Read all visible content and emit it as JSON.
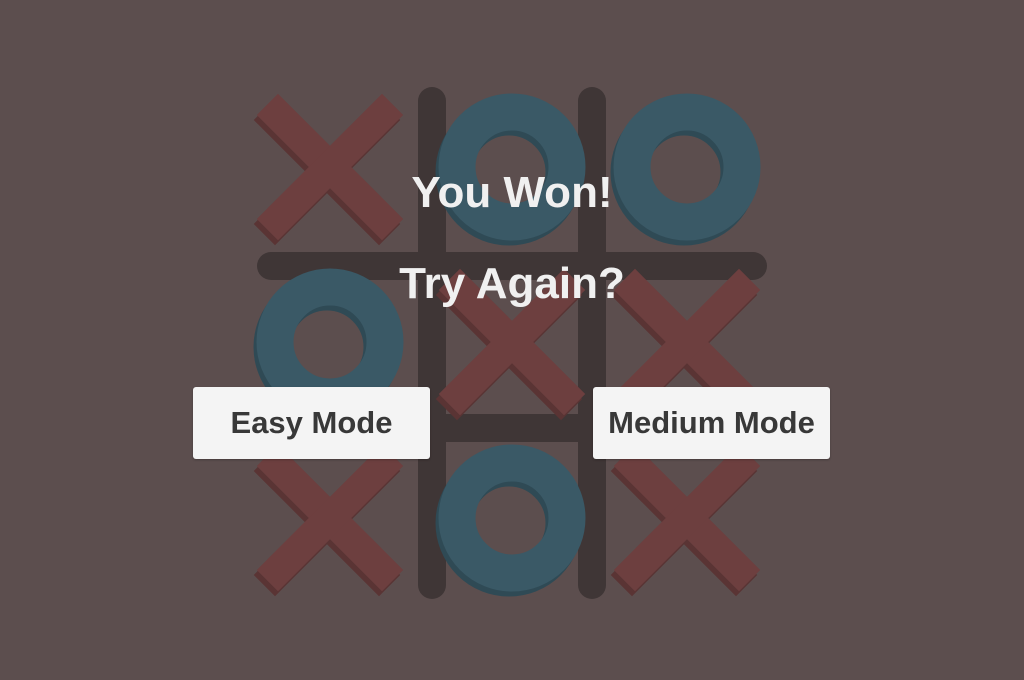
{
  "overlay": {
    "result_title": "You Won!",
    "retry_prompt": "Try Again?"
  },
  "buttons": {
    "easy_label": "Easy Mode",
    "medium_label": "Medium Mode"
  },
  "board": {
    "cells": [
      [
        "X",
        "O",
        "O"
      ],
      [
        "O",
        "X",
        "X"
      ],
      [
        "X",
        "O",
        "X"
      ]
    ]
  },
  "colors": {
    "background": "#5c4e4e",
    "grid_lines": "#3f3636",
    "x_mark": "#6d3f3f",
    "x_mark_shadow": "#5a3434",
    "o_mark": "#3a5966",
    "o_mark_shadow": "#2f4a55",
    "button_bg": "#f4f4f4",
    "button_text": "#383838",
    "overlay_text": "#f0f0f0"
  }
}
